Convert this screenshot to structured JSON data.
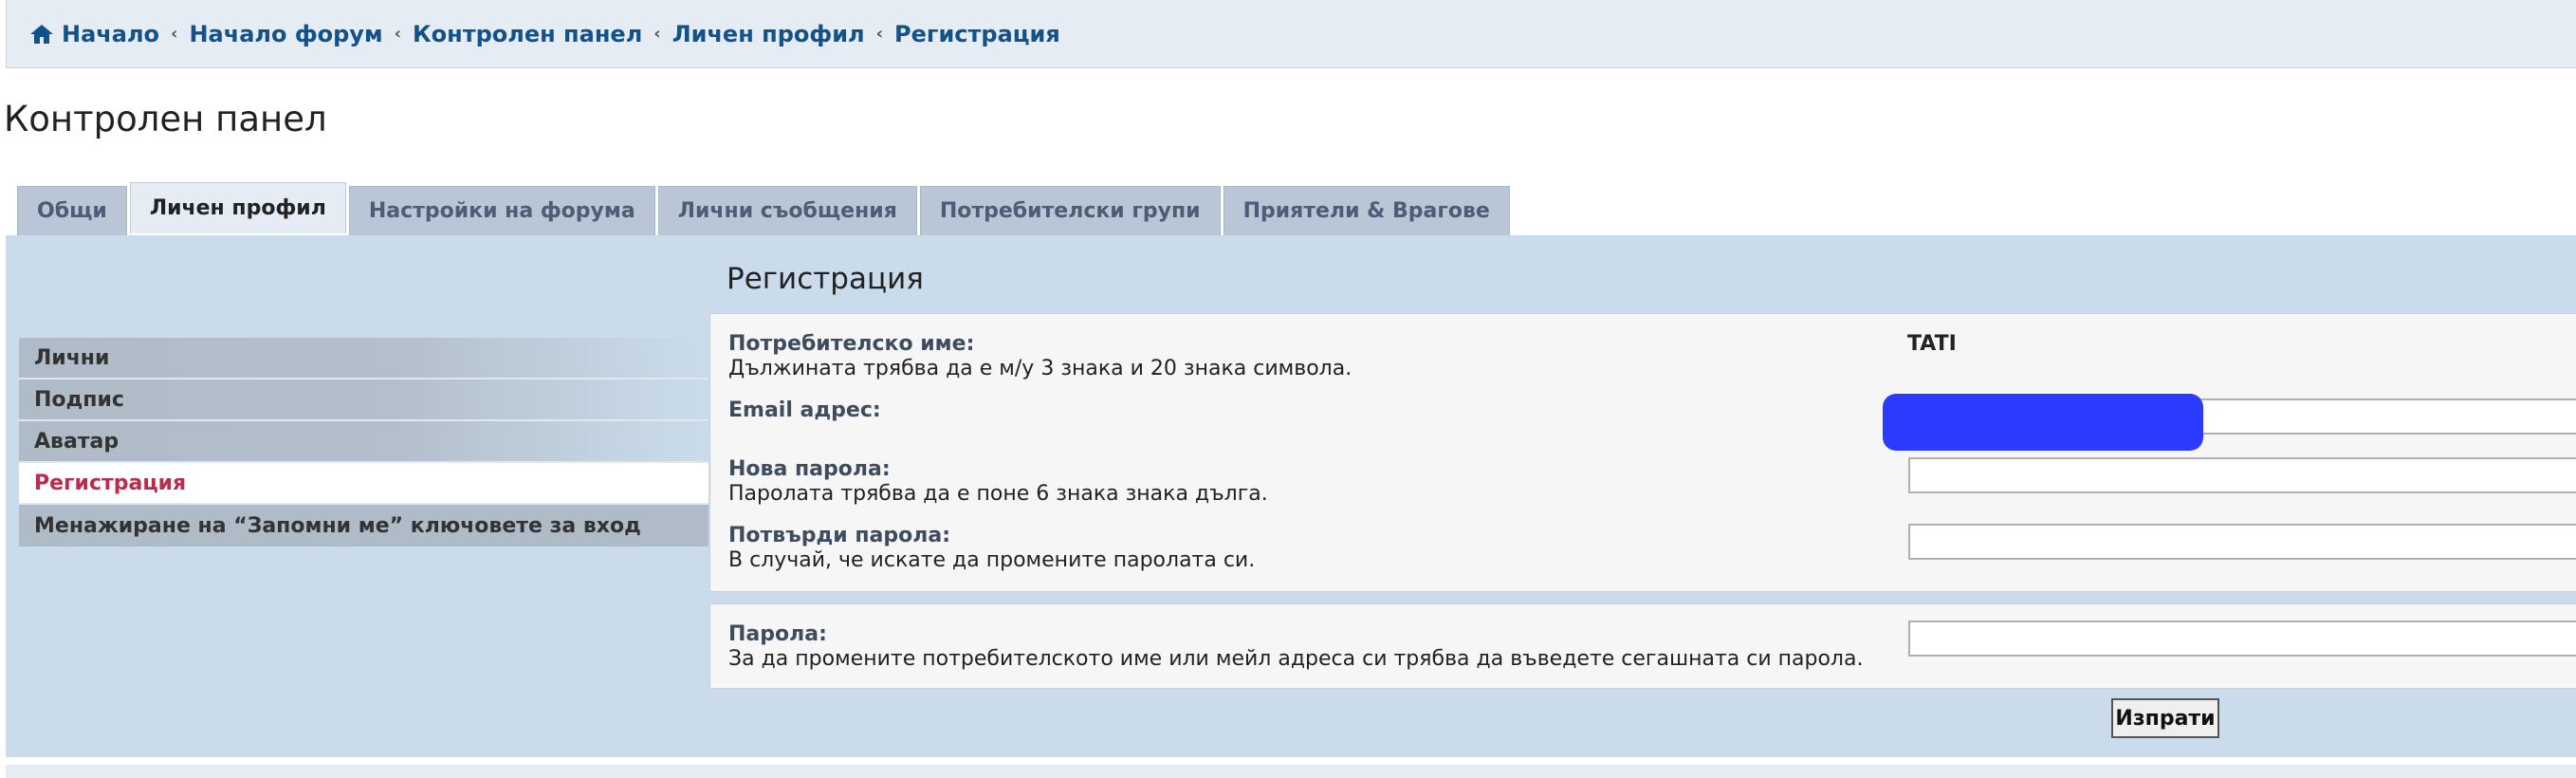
{
  "breadcrumbs": {
    "home": "Начало",
    "items": [
      "Начало форум",
      "Контролен панел",
      "Личен профил",
      "Регистрация"
    ]
  },
  "page_title": "Контролен панел",
  "tabs": [
    "Общи",
    "Личен профил",
    "Настройки на форума",
    "Лични съобщения",
    "Потребителски групи",
    "Приятели & Врагове"
  ],
  "active_tab": "Личен профил",
  "sidebar": {
    "items": [
      "Лични",
      "Подпис",
      "Аватар",
      "Регистрация",
      "Менажиране на “Запомни ме” ключовете за вход"
    ],
    "active": "Регистрация"
  },
  "form": {
    "title": "Регистрация",
    "username_label": "Потребителско име:",
    "username_hint": "Дължината трябва да е м/у 3 знака и 20 знака символа.",
    "username_value": "TATI",
    "email_label": "Email адрес:",
    "new_password_label": "Нова парола:",
    "new_password_hint": "Паролата трябва да е поне 6 знака знака дълга.",
    "confirm_password_label": "Потвърди парола:",
    "confirm_password_hint": "В случай, че искате да промените паролата си.",
    "current_password_label": "Парола:",
    "current_password_hint": "За да промените потребителското име или мейл адреса си трябва да въведете сегашната си парола.",
    "submit_label": "Изпрати"
  },
  "colors": {
    "link": "#105289",
    "active_menu": "#bc2a4d",
    "panel_bg": "#cadceb",
    "redaction": "#2a3aff"
  }
}
